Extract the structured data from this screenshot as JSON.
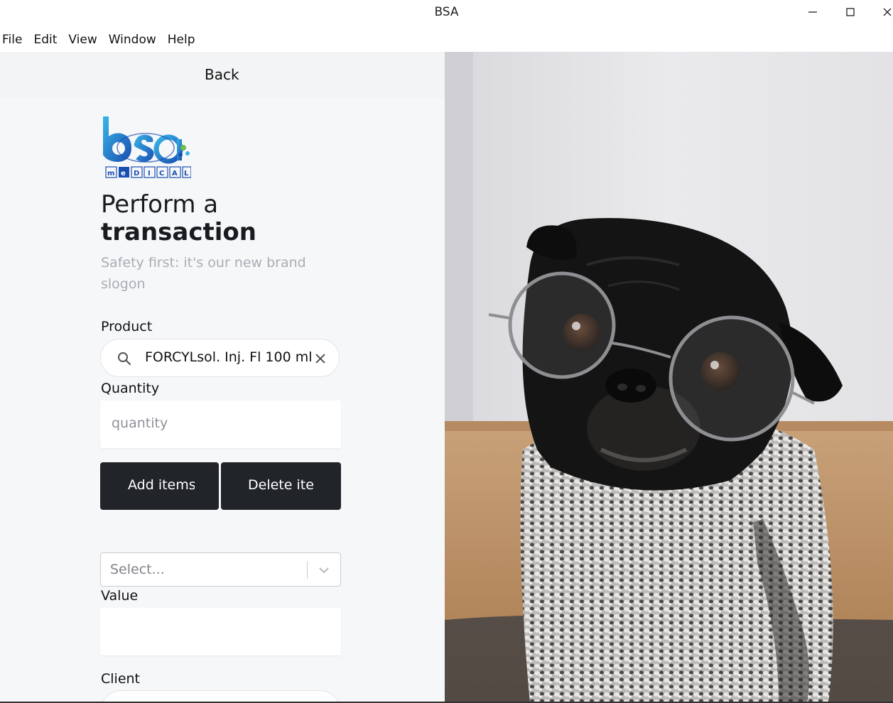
{
  "window": {
    "title": "BSA",
    "minimize_icon": "minimize-icon",
    "maximize_icon": "maximize-icon",
    "close_icon": "close-icon"
  },
  "menubar": {
    "items": [
      "File",
      "Edit",
      "View",
      "Window",
      "Help"
    ]
  },
  "page": {
    "back_label": "Back",
    "logo_text": "bsa MEDICAL",
    "heading_line1": "Perform a",
    "heading_line2": "transaction",
    "slogan": "Safety first: it's our new brand slogon"
  },
  "form": {
    "product_label": "Product",
    "product_value": "FORCYLsol. Inj. Fl 100 ml",
    "quantity_label": "Quantity",
    "quantity_placeholder": "quantity",
    "add_button": "Add items",
    "delete_button": "Delete items",
    "select_placeholder": "Select...",
    "value_label": "Value",
    "client_label": "Client"
  },
  "colors": {
    "panel_bg": "#f6f7f9",
    "button_bg": "#212429",
    "logo_blue": "#1c6fc7",
    "muted_text": "#a9adb4"
  }
}
